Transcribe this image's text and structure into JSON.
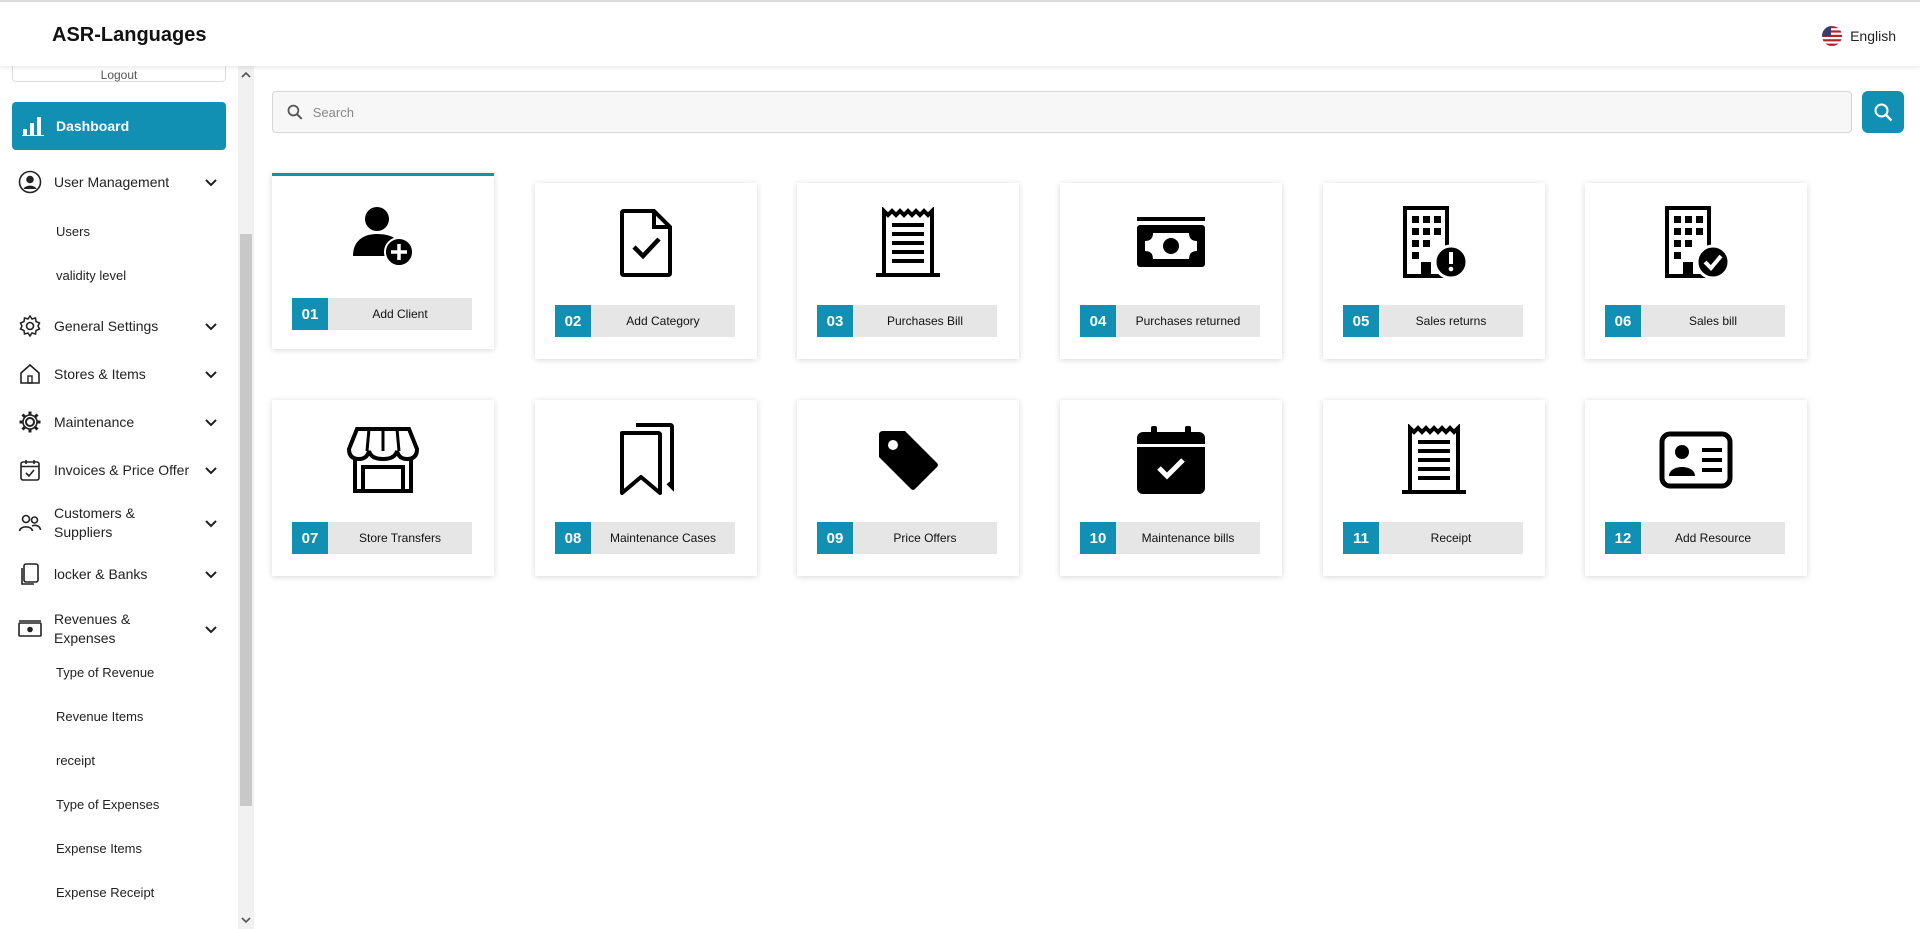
{
  "header": {
    "brand": "ASR-Languages",
    "language": "English"
  },
  "sidebar": {
    "logout_label": "Logout",
    "dashboard": "Dashboard",
    "items": [
      {
        "label": "User Management",
        "icon": "user-circle-icon"
      },
      {
        "label": "Users"
      },
      {
        "label": "validity level"
      },
      {
        "label": "General Settings",
        "icon": "gear-icon"
      },
      {
        "label": "Stores & Items",
        "icon": "house-icon"
      },
      {
        "label": "Maintenance",
        "icon": "cog-icon"
      },
      {
        "label": "Invoices & Price Offer",
        "icon": "invoice-icon"
      },
      {
        "label": "Customers & Suppliers",
        "icon": "people-icon"
      },
      {
        "label": "locker & Banks",
        "icon": "copy-icon"
      },
      {
        "label": "Revenues & Expenses",
        "icon": "cash-icon"
      },
      {
        "label": "Type of Revenue"
      },
      {
        "label": "Revenue Items"
      },
      {
        "label": "receipt"
      },
      {
        "label": "Type of Expenses"
      },
      {
        "label": "Expense Items"
      },
      {
        "label": "Expense Receipt"
      }
    ]
  },
  "search": {
    "placeholder": "Search",
    "value": ""
  },
  "cards": [
    {
      "num": "01",
      "label": "Add Client",
      "icon": "add-user-icon"
    },
    {
      "num": "02",
      "label": "Add Category",
      "icon": "file-check-icon"
    },
    {
      "num": "03",
      "label": "Purchases Bill",
      "icon": "receipt-icon"
    },
    {
      "num": "04",
      "label": "Purchases returned",
      "icon": "money-icon"
    },
    {
      "num": "05",
      "label": "Sales returns",
      "icon": "building-alert-icon"
    },
    {
      "num": "06",
      "label": "Sales bill",
      "icon": "building-check-icon"
    },
    {
      "num": "07",
      "label": "Store Transfers",
      "icon": "shop-icon"
    },
    {
      "num": "08",
      "label": "Maintenance Cases",
      "icon": "bookmarks-icon"
    },
    {
      "num": "09",
      "label": "Price Offers",
      "icon": "tag-icon"
    },
    {
      "num": "10",
      "label": "Maintenance bills",
      "icon": "calendar-check-icon"
    },
    {
      "num": "11",
      "label": "Receipt",
      "icon": "receipt-icon"
    },
    {
      "num": "12",
      "label": "Add Resource",
      "icon": "id-card-icon"
    }
  ],
  "colors": {
    "accent": "#1190b4",
    "label_bg": "#e6e6e6"
  }
}
